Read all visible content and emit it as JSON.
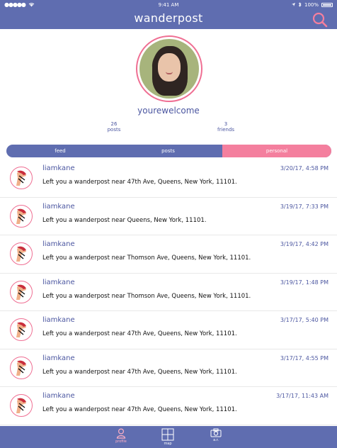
{
  "status_bar": {
    "signal": "●●●●●",
    "time": "9:41 AM",
    "battery": "100%"
  },
  "nav": {
    "title": "wanderpost"
  },
  "profile": {
    "username": "yourewelcome",
    "posts_count": "26",
    "posts_label": "posts",
    "friends_count": "3",
    "friends_label": "friends"
  },
  "tabs": {
    "items": [
      "feed",
      "posts",
      "personal"
    ],
    "selected": "personal"
  },
  "posts": [
    {
      "author": "liamkane",
      "date": "3/20/17, 4:58 PM",
      "message": "Left you a wanderpost near 47th Ave, Queens, New York, 11101."
    },
    {
      "author": "liamkane",
      "date": "3/19/17, 7:33 PM",
      "message": "Left you a wanderpost near Queens, New York, 11101."
    },
    {
      "author": "liamkane",
      "date": "3/19/17, 4:42 PM",
      "message": "Left you a wanderpost near Thomson Ave, Queens, New York, 11101."
    },
    {
      "author": "liamkane",
      "date": "3/19/17, 1:48 PM",
      "message": "Left you a wanderpost near Thomson Ave, Queens, New York, 11101."
    },
    {
      "author": "liamkane",
      "date": "3/17/17, 5:40 PM",
      "message": "Left you a wanderpost near 47th Ave, Queens, New York, 11101."
    },
    {
      "author": "liamkane",
      "date": "3/17/17, 4:55 PM",
      "message": "Left you a wanderpost near 47th Ave, Queens, New York, 11101."
    },
    {
      "author": "liamkane",
      "date": "3/17/17, 11:43 AM",
      "message": "Left you a wanderpost near 47th Ave, Queens, New York, 11101."
    }
  ],
  "bottom_tabs": [
    {
      "label": "profile",
      "icon": "person-icon",
      "active": true
    },
    {
      "label": "map",
      "icon": "map-icon",
      "active": false
    },
    {
      "label": "a.r.",
      "icon": "camera-icon",
      "active": false
    }
  ],
  "colors": {
    "primary": "#5f6db0",
    "accent": "#f47f9e",
    "text": "#4b56a0",
    "background": "#ffffff"
  }
}
